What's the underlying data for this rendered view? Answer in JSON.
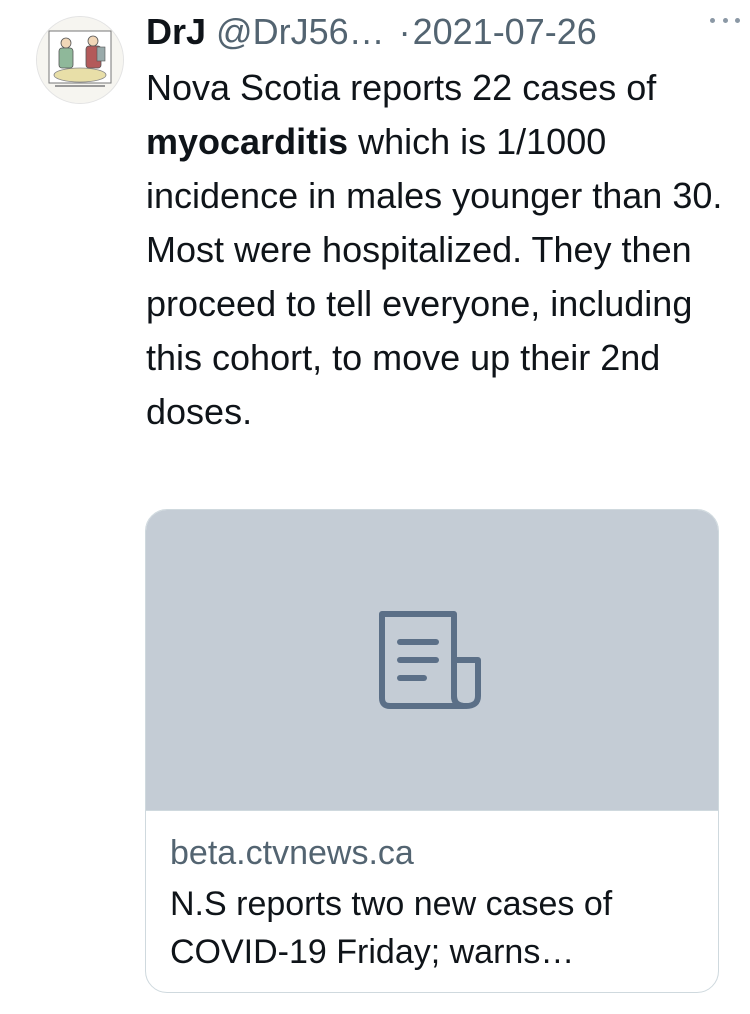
{
  "author": {
    "display_name": "DrJ",
    "handle": "@DrJ56…",
    "date": "2021-07-26",
    "separator": "·",
    "avatar_icon": "cartoon-avatar-icon"
  },
  "more_icon": "ellipsis-icon",
  "tweet": {
    "text_before_bold": "Nova Scotia reports 22 cases of ",
    "bold_text": "myocarditis",
    "text_after_bold": " which is 1/1000 incidence in males younger than 30. Most were hospitalized. They then proceed to tell everyone, including this cohort, to move up their 2nd doses."
  },
  "link_card": {
    "media_icon": "article-icon",
    "domain": "beta.ctvnews.ca",
    "title": "N.S reports two new cases of COVID-19 Friday; warns…"
  },
  "colors": {
    "text": "#0f1419",
    "secondary": "#536471",
    "card_border": "#cfd9de",
    "card_media_bg": "#c4ccd5",
    "article_icon": "#5b6f87"
  }
}
